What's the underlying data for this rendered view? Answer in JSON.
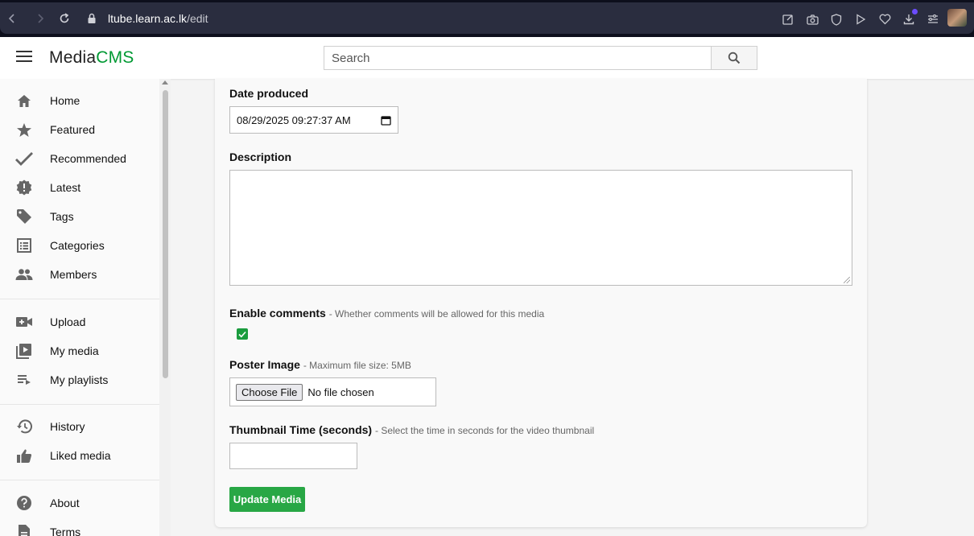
{
  "browser": {
    "url_host": "ltube.learn.ac.lk",
    "url_path": "/edit"
  },
  "header": {
    "logo_primary": "Media",
    "logo_accent": "CMS",
    "search_placeholder": "Search"
  },
  "sidebar": {
    "items": [
      {
        "label": "Home",
        "icon": "home-icon"
      },
      {
        "label": "Featured",
        "icon": "star-icon"
      },
      {
        "label": "Recommended",
        "icon": "checkmark-icon"
      },
      {
        "label": "Latest",
        "icon": "new-badge-icon"
      },
      {
        "label": "Tags",
        "icon": "tag-icon"
      },
      {
        "label": "Categories",
        "icon": "list-icon"
      },
      {
        "label": "Members",
        "icon": "people-icon"
      },
      {
        "label": "Upload",
        "icon": "video-add-icon"
      },
      {
        "label": "My media",
        "icon": "video-library-icon"
      },
      {
        "label": "My playlists",
        "icon": "playlist-icon"
      },
      {
        "label": "History",
        "icon": "history-icon"
      },
      {
        "label": "Liked media",
        "icon": "thumbs-up-icon"
      },
      {
        "label": "About",
        "icon": "help-icon"
      },
      {
        "label": "Terms",
        "icon": "document-icon"
      }
    ]
  },
  "form": {
    "date_label": "Date produced",
    "date_value": "08/29/2025 09:27:37 AM",
    "description_label": "Description",
    "description_value": "",
    "comments_label": "Enable comments",
    "comments_hint": "- Whether comments will be allowed for this media",
    "comments_checked": true,
    "poster_label": "Poster Image",
    "poster_hint": "- Maximum file size: 5MB",
    "file_button": "Choose File",
    "file_status": "No file chosen",
    "thumb_label": "Thumbnail Time (seconds)",
    "thumb_hint": "- Select the time in seconds for the video thumbnail",
    "thumb_value": "",
    "submit_label": "Update Media"
  },
  "colors": {
    "accent": "#009933",
    "button": "#28a745",
    "browser_bg": "#2a2d3f"
  }
}
